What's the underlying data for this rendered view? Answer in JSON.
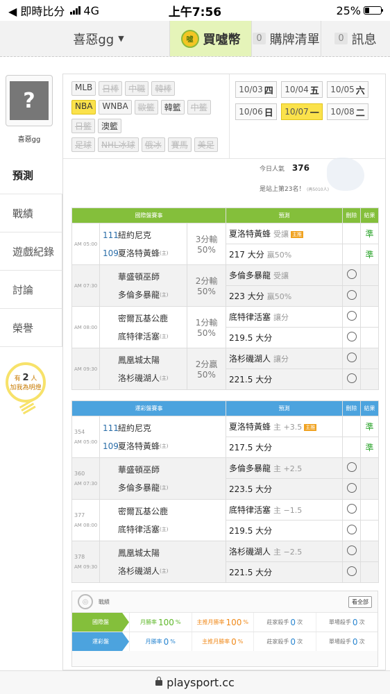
{
  "status": {
    "back_label": "◀ 即時比分",
    "network": "4G",
    "time": "上午7:56",
    "battery": "25%",
    "battery_level": 0.25
  },
  "topnav": {
    "user": "喜惡gg",
    "buy": "買噓幣",
    "coin_text": "噓",
    "cart_count": "0",
    "cart": "購牌清單",
    "msg_count": "0",
    "msg": "訊息"
  },
  "sidebar": {
    "username": "喜惡gg",
    "menu": [
      "預測",
      "戰績",
      "遊戲紀錄",
      "討論",
      "榮譽"
    ],
    "fan_prefix": "有",
    "fan_count": "2",
    "fan_suffix": "人",
    "fan_cta": "加我為明燈"
  },
  "leagues": {
    "row1": [
      {
        "t": "MLB",
        "s": ""
      },
      {
        "t": "日棒",
        "s": "off"
      },
      {
        "t": "中職",
        "s": "off"
      },
      {
        "t": "韓棒",
        "s": "off"
      }
    ],
    "row2": [
      {
        "t": "NBA",
        "s": "sel"
      },
      {
        "t": "WNBA",
        "s": ""
      },
      {
        "t": "歐籃",
        "s": "off"
      },
      {
        "t": "韓籃",
        "s": ""
      },
      {
        "t": "中籃",
        "s": "off"
      }
    ],
    "row3": [
      {
        "t": "日籃",
        "s": "off"
      },
      {
        "t": "澳籃",
        "s": ""
      }
    ],
    "row4": [
      {
        "t": "足球",
        "s": "off"
      },
      {
        "t": "NHL冰球",
        "s": "off"
      },
      {
        "t": "俄冰",
        "s": "off"
      },
      {
        "t": "賽馬",
        "s": "off"
      },
      {
        "t": "美足",
        "s": "off"
      }
    ]
  },
  "dates": [
    {
      "d": "10/03",
      "w": "四",
      "sel": false
    },
    {
      "d": "10/04",
      "w": "五",
      "sel": false
    },
    {
      "d": "10/05",
      "w": "六",
      "sel": false
    },
    {
      "d": "10/06",
      "w": "日",
      "sel": false
    },
    {
      "d": "10/07",
      "w": "一",
      "sel": true
    },
    {
      "d": "10/08",
      "w": "二",
      "sel": false
    }
  ],
  "popularity": {
    "label": "今日人氣",
    "value": "376",
    "rank_text": "是站上第23名！",
    "rank_suffix": "(再5010人)"
  },
  "intl": {
    "header": [
      "國際盤賽事",
      "預測",
      "刪除",
      "結果"
    ],
    "games": [
      {
        "time": "AM 05:00",
        "away_id": "111",
        "away": "紐約尼克",
        "home_id": "109",
        "home": "夏洛特黃蜂",
        "line1": "3分輸",
        "line2": "50%",
        "pick1": "夏洛特黃蜂",
        "pick1_note": "受讓",
        "pick1_tag": "主推",
        "pick2": "217 大分",
        "pick2_note": "贏50%",
        "res1": "準",
        "res2": "準"
      },
      {
        "time": "AM 07:30",
        "away_id": "",
        "away": "華盛頓巫師",
        "home_id": "",
        "home": "多倫多暴龍",
        "line1": "2分輸",
        "line2": "50%",
        "pick1": "多倫多暴龍",
        "pick1_note": "受讓",
        "pick1_tag": "",
        "pick2": "223 大分",
        "pick2_note": "贏50%",
        "res1": "",
        "res2": ""
      },
      {
        "time": "AM 08:00",
        "away_id": "",
        "away": "密爾瓦基公鹿",
        "home_id": "",
        "home": "底特律活塞",
        "line1": "1分輸",
        "line2": "50%",
        "pick1": "底特律活塞",
        "pick1_note": "讓分",
        "pick1_tag": "",
        "pick2": "219.5 大分",
        "pick2_note": "",
        "res1": "",
        "res2": ""
      },
      {
        "time": "AM 09:30",
        "away_id": "",
        "away": "鳳凰城太陽",
        "home_id": "",
        "home": "洛杉磯湖人",
        "line1": "2分贏",
        "line2": "50%",
        "pick1": "洛杉磯湖人",
        "pick1_note": "讓分",
        "pick1_tag": "",
        "pick2": "221.5 大分",
        "pick2_note": "",
        "res1": "",
        "res2": ""
      }
    ]
  },
  "lottery": {
    "header": [
      "運彩盤賽事",
      "預測",
      "刪除",
      "結果"
    ],
    "games": [
      {
        "num": "354",
        "time": "AM 05:00",
        "away_id": "111",
        "away": "紐約尼克",
        "home_id": "109",
        "home": "夏洛特黃蜂",
        "pick1": "夏洛特黃蜂",
        "pick1_note": "主 +3.5",
        "pick1_tag": "主推",
        "pick2": "217.5 大分",
        "res1": "準",
        "res2": "準"
      },
      {
        "num": "360",
        "time": "AM 07:30",
        "away_id": "",
        "away": "華盛頓巫師",
        "home_id": "",
        "home": "多倫多暴龍",
        "pick1": "多倫多暴龍",
        "pick1_note": "主 +2.5",
        "pick1_tag": "",
        "pick2": "223.5 大分",
        "res1": "",
        "res2": ""
      },
      {
        "num": "377",
        "time": "AM 08:00",
        "away_id": "",
        "away": "密爾瓦基公鹿",
        "home_id": "",
        "home": "底特律活塞",
        "pick1": "底特律活塞",
        "pick1_note": "主 −1.5",
        "pick1_tag": "",
        "pick2": "219.5 大分",
        "res1": "",
        "res2": ""
      },
      {
        "num": "378",
        "time": "AM 09:30",
        "away_id": "",
        "away": "鳳凰城太陽",
        "home_id": "",
        "home": "洛杉磯湖人",
        "pick1": "洛杉磯湖人",
        "pick1_note": "主 −2.5",
        "pick1_tag": "",
        "pick2": "221.5 大分",
        "res1": "",
        "res2": ""
      }
    ]
  },
  "home_marker": "(主)",
  "stats": {
    "title": "戰績",
    "see_all": "看全部",
    "rows": [
      {
        "label": "國際盤",
        "c1l": "月勝率",
        "c1v": "100",
        "c1u": "%",
        "c2l": "主推月勝率",
        "c2v": "100",
        "c2u": "%",
        "c3l": "莊家殺手",
        "c3v": "0",
        "c3u": "次",
        "c4l": "單場殺手",
        "c4v": "0",
        "c4u": "次"
      },
      {
        "label": "運彩盤",
        "c1l": "月勝率",
        "c1v": "0",
        "c1u": "%",
        "c2l": "主推月勝率",
        "c2v": "0",
        "c2u": "%",
        "c3l": "莊家殺手",
        "c3v": "0",
        "c3u": "次",
        "c4l": "單場殺手",
        "c4v": "0",
        "c4u": "次"
      }
    ]
  },
  "url": "playsport.cc",
  "colors": {
    "green": "#84bf3b",
    "blue": "#4ca3de",
    "selected": "#fbe24b",
    "result": "#2fa52f"
  }
}
